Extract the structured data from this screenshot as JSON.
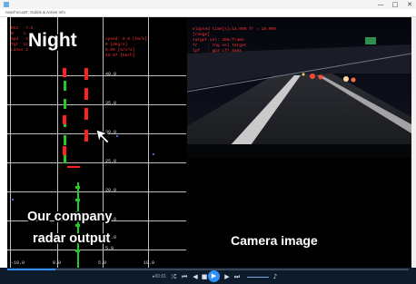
{
  "window": {
    "title": "nearFocusR: Oulink & Active Info",
    "controls": {
      "minimize": "—",
      "maximize": "□",
      "close": "✕"
    }
  },
  "overlay": {
    "night_label": "Night",
    "radar_label_line1": "Our company",
    "radar_label_line2": "radar output",
    "camera_label": "Camera image"
  },
  "radar": {
    "info_lines": "RCS  -7.5\nN    1.7\nSpd  -3.1\nTgt  11\nLanes 2",
    "info_lines_right": "speed: 0.0 [km/h]\n0 [deg/s]\n0.00 [m/s^2]\n18.97 [km/h]",
    "y_ticks": [
      "40.0",
      "35.0",
      "30.0",
      "25.0",
      "20.0",
      "15.0",
      "10.0",
      "5.0"
    ],
    "x_ticks": [
      "-10.0",
      "0.0",
      "5.0",
      "10.0"
    ],
    "lane_color": "#22cc22",
    "target_color": "#ff2020",
    "cursor_icon": "arrow-cursor-icon"
  },
  "camera": {
    "info_lines": "elapsed time[s]=14.000 fr = 18.000\n[range]\ntarget vel: 30m/frame\nfr    : rng vel target\nlpf   : gp3 cf7 8a6s"
  },
  "player": {
    "progress_fraction": 0.12,
    "time_text": "▸00:01",
    "icons": [
      "shuffle-icon",
      "previous-icon",
      "rewind-icon",
      "stop-icon",
      "play-icon",
      "forward-icon",
      "next-icon",
      "volume-icon"
    ]
  },
  "colors": {
    "accent": "#2f8fff",
    "player_bg": "#0d1b2a",
    "stage_bg": "#000000"
  }
}
